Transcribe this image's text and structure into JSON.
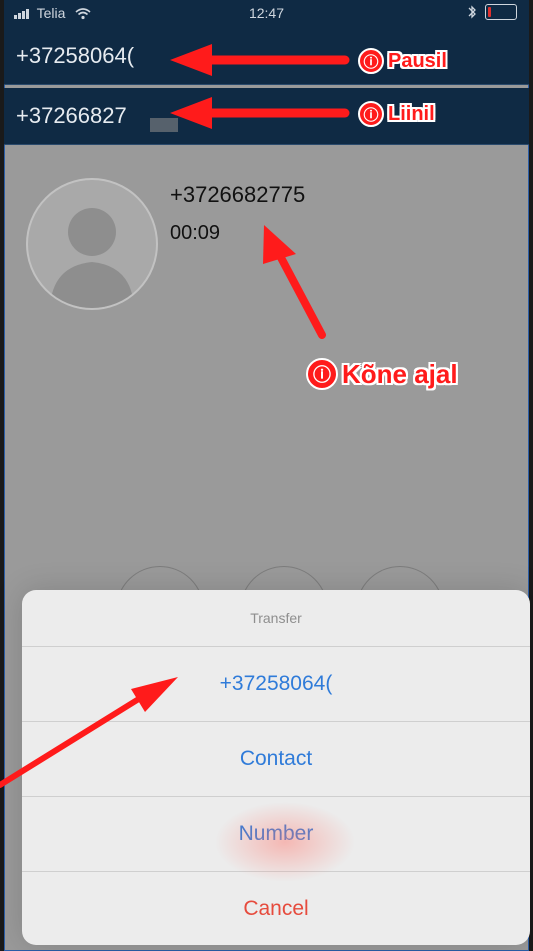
{
  "status_bar": {
    "carrier": "Telia",
    "time": "12:47"
  },
  "calls": {
    "paused_number": "+37258064(",
    "line_number": "+37266827",
    "active": {
      "number": "+3726682775",
      "timer": "00:09"
    }
  },
  "notes": {
    "paused": {
      "icon_glyph": "ⓘ",
      "label": "Pausil"
    },
    "line": {
      "icon_glyph": "ⓘ",
      "label": "Liinil"
    },
    "during_call": {
      "icon_glyph": "ⓘ",
      "label": "Kõne ajal"
    }
  },
  "transfer_sheet": {
    "title": "Transfer",
    "options": [
      {
        "label": "+37258064("
      },
      {
        "label": "Contact"
      },
      {
        "label": "Number"
      }
    ],
    "cancel": "Cancel"
  },
  "colors": {
    "header_bg": "#0f2a44",
    "action_blue": "#2f7bd9",
    "cancel_red": "#e64b3d",
    "annotation_red": "#ff1b1b"
  },
  "icons": [
    "signal-icon",
    "wifi-icon",
    "bluetooth-icon",
    "battery-icon",
    "avatar-placeholder-icon",
    "info-icon"
  ]
}
